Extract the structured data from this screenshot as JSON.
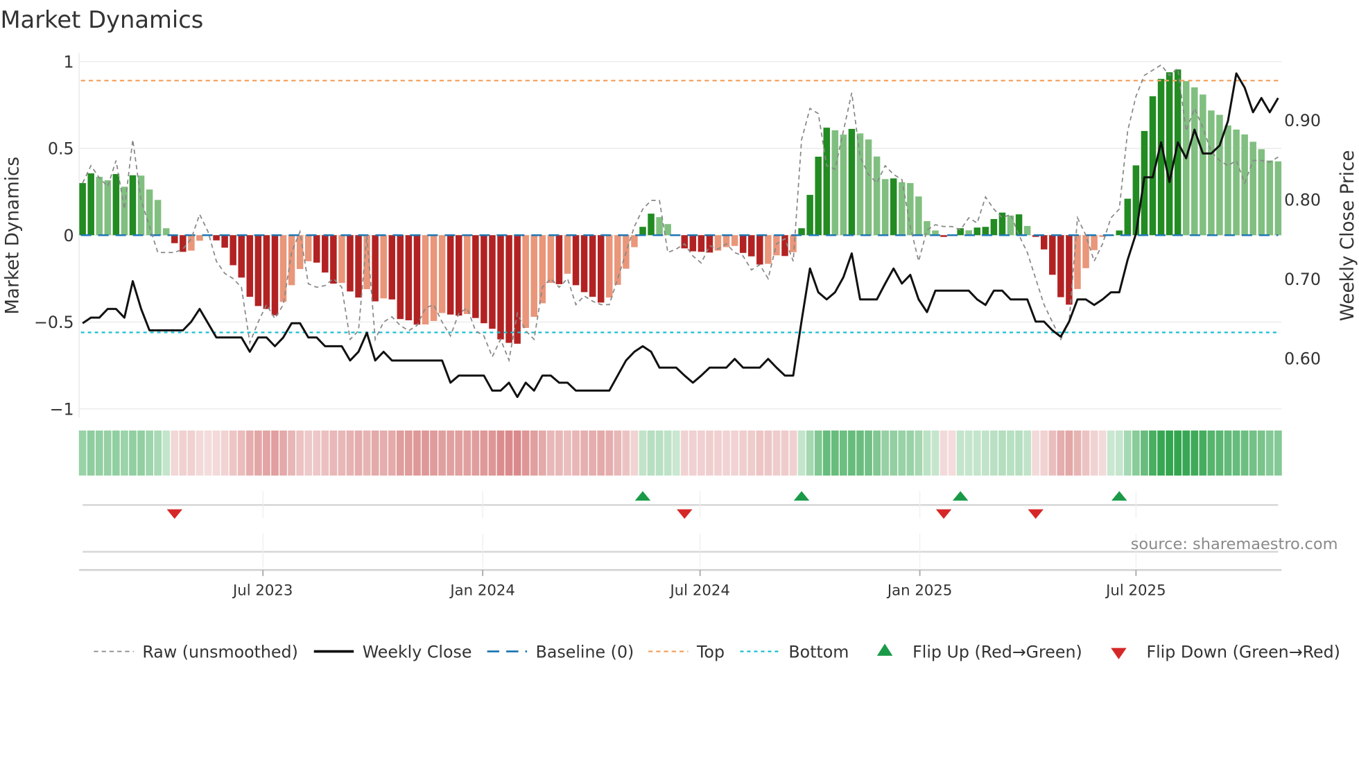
{
  "chart_data": {
    "type": "bar",
    "title": "Market Dynamics",
    "ylabel": "Market Dynamics",
    "ylabel_right": "Weekly Close Price",
    "source": "source: sharemaestro.com",
    "x_start": "2023-01-31",
    "x_step_days": 7,
    "ylim": [
      -1.0,
      1.0
    ],
    "ylim_right": [
      0.536,
      0.974
    ],
    "yticks": [
      {
        "v": 1,
        "label": "1"
      },
      {
        "v": 0.5,
        "label": "0.5"
      },
      {
        "v": 0,
        "label": "0"
      },
      {
        "v": -0.5,
        "label": "−0.5"
      },
      {
        "v": -1,
        "label": "−1"
      }
    ],
    "yticks_right": [
      {
        "v": 0.9,
        "label": "0.90"
      },
      {
        "v": 0.8,
        "label": "0.80"
      },
      {
        "v": 0.7,
        "label": "0.70"
      },
      {
        "v": 0.6,
        "label": "0.60"
      }
    ],
    "xticks": [
      {
        "date": "2023-07-01",
        "label": "Jul 2023"
      },
      {
        "date": "2024-01-01",
        "label": "Jan 2024"
      },
      {
        "date": "2024-07-01",
        "label": "Jul 2024"
      },
      {
        "date": "2025-01-01",
        "label": "Jan 2025"
      },
      {
        "date": "2025-07-01",
        "label": "Jul 2025"
      }
    ],
    "top": 0.89,
    "bottom": -0.56,
    "baseline": 0,
    "colors": {
      "up_strong": "#228b22",
      "up_weak": "#80bf80",
      "down_strong": "#b22222",
      "down_weak": "#e9967a",
      "raw": "#888888",
      "close": "#111111",
      "baseline": "#1f77b4",
      "top": "#f4a261",
      "bottom": "#17becf",
      "flip_up": "#1a9a48",
      "flip_down": "#d62728",
      "strip_green": "40,160,70",
      "strip_red": "200,80,80"
    },
    "values": [
      0.3,
      0.356,
      0.336,
      0.316,
      0.352,
      0.279,
      0.345,
      0.343,
      0.263,
      0.203,
      0.04,
      -0.046,
      -0.096,
      -0.089,
      -0.032,
      -0.005,
      -0.03,
      -0.072,
      -0.173,
      -0.244,
      -0.355,
      -0.408,
      -0.425,
      -0.461,
      -0.384,
      -0.288,
      -0.195,
      -0.15,
      -0.158,
      -0.215,
      -0.279,
      -0.275,
      -0.324,
      -0.359,
      -0.311,
      -0.381,
      -0.364,
      -0.37,
      -0.483,
      -0.49,
      -0.515,
      -0.514,
      -0.494,
      -0.448,
      -0.457,
      -0.463,
      -0.454,
      -0.477,
      -0.507,
      -0.539,
      -0.6,
      -0.62,
      -0.625,
      -0.534,
      -0.47,
      -0.392,
      -0.275,
      -0.282,
      -0.222,
      -0.288,
      -0.328,
      -0.355,
      -0.388,
      -0.359,
      -0.286,
      -0.193,
      -0.069,
      0.048,
      0.124,
      0.104,
      0.064,
      0.0,
      -0.076,
      -0.093,
      -0.096,
      -0.1,
      -0.089,
      -0.069,
      -0.062,
      -0.102,
      -0.122,
      -0.169,
      -0.165,
      -0.116,
      -0.12,
      -0.098,
      0.04,
      0.232,
      0.452,
      0.619,
      0.604,
      0.579,
      0.612,
      0.586,
      0.551,
      0.453,
      0.323,
      0.327,
      0.305,
      0.3,
      0.223,
      0.081,
      0.027,
      -0.01,
      -0.002,
      0.04,
      0.028,
      0.044,
      0.048,
      0.093,
      0.13,
      0.113,
      0.12,
      0.053,
      -0.01,
      -0.082,
      -0.228,
      -0.357,
      -0.4,
      -0.31,
      -0.19,
      -0.086,
      -0.01,
      0.0,
      0.027,
      0.21,
      0.402,
      0.6,
      0.8,
      0.9,
      0.938,
      0.954,
      0.887,
      0.851,
      0.81,
      0.718,
      0.693,
      0.632,
      0.608,
      0.58,
      0.538,
      0.495,
      0.43,
      0.425
    ],
    "raw": [
      0.3,
      0.4,
      0.33,
      0.28,
      0.43,
      0.15,
      0.55,
      0.2,
      0.05,
      -0.1,
      -0.1,
      -0.1,
      -0.08,
      -0.02,
      0.12,
      0.02,
      -0.15,
      -0.22,
      -0.25,
      -0.3,
      -0.62,
      -0.5,
      -0.4,
      -0.48,
      -0.4,
      -0.1,
      0.02,
      -0.28,
      -0.3,
      -0.29,
      -0.25,
      -0.3,
      -0.6,
      -0.55,
      0.0,
      -0.6,
      -0.5,
      -0.47,
      -0.52,
      -0.55,
      -0.52,
      -0.42,
      -0.4,
      -0.5,
      -0.58,
      -0.45,
      -0.42,
      -0.55,
      -0.58,
      -0.7,
      -0.6,
      -0.72,
      -0.45,
      -0.55,
      -0.6,
      -0.3,
      -0.25,
      -0.3,
      -0.25,
      -0.4,
      -0.35,
      -0.38,
      -0.4,
      -0.4,
      -0.25,
      -0.1,
      0.05,
      0.15,
      0.2,
      0.2,
      -0.1,
      -0.08,
      -0.05,
      -0.12,
      -0.16,
      -0.06,
      -0.08,
      -0.05,
      -0.1,
      -0.12,
      -0.2,
      -0.17,
      -0.25,
      -0.05,
      -0.02,
      -0.15,
      0.55,
      0.73,
      0.7,
      0.4,
      0.38,
      0.6,
      0.82,
      0.45,
      0.35,
      0.3,
      0.4,
      0.35,
      0.32,
      0.05,
      -0.15,
      0.03,
      0.06,
      0.05,
      0.05,
      0.03,
      0.1,
      0.07,
      0.22,
      0.15,
      0.1,
      0.12,
      0.0,
      -0.1,
      -0.25,
      -0.4,
      -0.5,
      -0.6,
      -0.5,
      0.1,
      0.0,
      -0.15,
      -0.05,
      0.1,
      0.15,
      0.6,
      0.8,
      0.92,
      0.95,
      0.98,
      0.92,
      0.96,
      0.6,
      0.73,
      0.62,
      0.48,
      0.43,
      0.4,
      0.43,
      0.3,
      0.43,
      0.43,
      0.42,
      0.45
    ],
    "close": [
      0.644,
      0.651,
      0.651,
      0.662,
      0.662,
      0.651,
      0.697,
      0.662,
      0.635,
      0.635,
      0.635,
      0.635,
      0.635,
      0.646,
      0.662,
      0.644,
      0.626,
      0.626,
      0.626,
      0.626,
      0.608,
      0.626,
      0.626,
      0.615,
      0.626,
      0.644,
      0.644,
      0.626,
      0.626,
      0.615,
      0.615,
      0.615,
      0.597,
      0.608,
      0.632,
      0.597,
      0.608,
      0.597,
      0.597,
      0.597,
      0.597,
      0.597,
      0.597,
      0.597,
      0.569,
      0.578,
      0.578,
      0.578,
      0.578,
      0.559,
      0.559,
      0.569,
      0.551,
      0.569,
      0.559,
      0.578,
      0.578,
      0.569,
      0.569,
      0.559,
      0.559,
      0.559,
      0.559,
      0.559,
      0.578,
      0.597,
      0.608,
      0.615,
      0.608,
      0.588,
      0.588,
      0.588,
      0.578,
      0.569,
      0.578,
      0.588,
      0.588,
      0.588,
      0.599,
      0.588,
      0.588,
      0.588,
      0.599,
      0.588,
      0.578,
      0.578,
      0.647,
      0.713,
      0.683,
      0.674,
      0.683,
      0.702,
      0.732,
      0.674,
      0.674,
      0.674,
      0.694,
      0.713,
      0.694,
      0.705,
      0.674,
      0.658,
      0.685,
      0.685,
      0.685,
      0.685,
      0.685,
      0.674,
      0.667,
      0.685,
      0.685,
      0.674,
      0.674,
      0.674,
      0.646,
      0.646,
      0.635,
      0.627,
      0.646,
      0.674,
      0.674,
      0.667,
      0.674,
      0.683,
      0.683,
      0.724,
      0.757,
      0.828,
      0.828,
      0.872,
      0.822,
      0.872,
      0.852,
      0.888,
      0.858,
      0.858,
      0.868,
      0.899,
      0.959,
      0.941,
      0.91,
      0.928,
      0.91,
      0.928
    ],
    "flips_up": [
      67,
      86,
      105,
      124
    ],
    "flips_down": [
      11,
      72,
      103,
      114
    ],
    "legend": {
      "position": "bottom",
      "items": [
        {
          "key": "raw",
          "label": "Raw (unsmoothed)"
        },
        {
          "key": "close",
          "label": "Weekly Close"
        },
        {
          "key": "baseline",
          "label": "Baseline (0)"
        },
        {
          "key": "top",
          "label": "Top"
        },
        {
          "key": "bottom",
          "label": "Bottom"
        },
        {
          "key": "flip_up",
          "label": "Flip Up (Red→Green)"
        },
        {
          "key": "flip_down",
          "label": "Flip Down (Green→Red)"
        }
      ]
    }
  }
}
